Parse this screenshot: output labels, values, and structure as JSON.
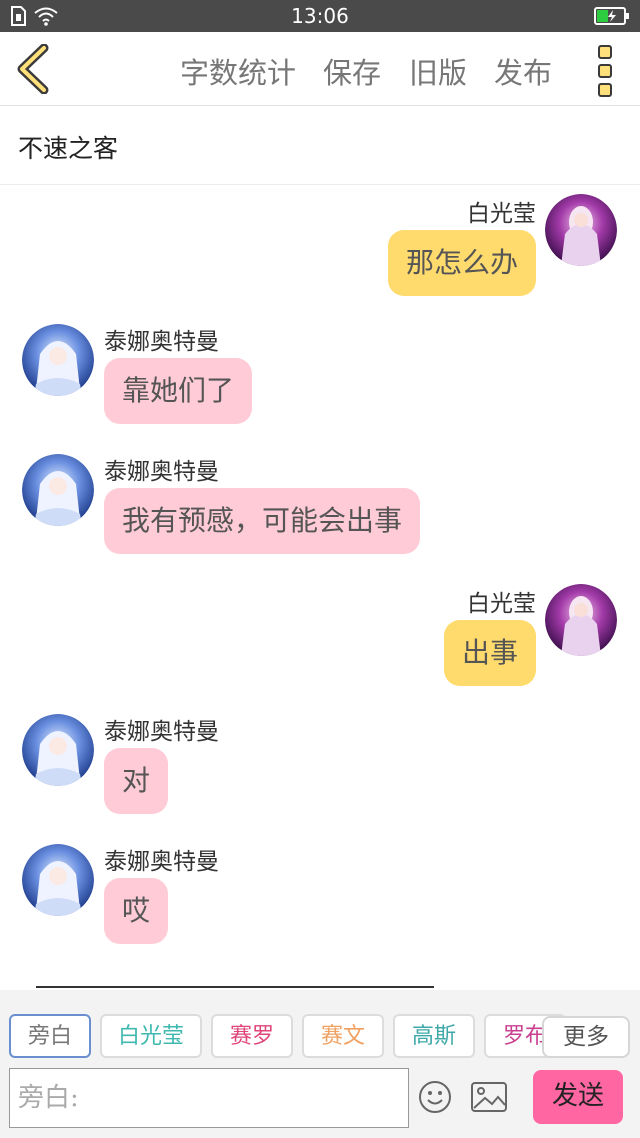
{
  "status_bar": {
    "time": "13:06"
  },
  "nav": {
    "actions": [
      "字数统计",
      "保存",
      "旧版",
      "发布"
    ]
  },
  "story": {
    "title": "不速之客"
  },
  "messages": [
    {
      "side": "right",
      "name": "白光莹",
      "text": "那怎么办"
    },
    {
      "side": "left",
      "name": "泰娜奥特曼",
      "text": "靠她们了"
    },
    {
      "side": "left",
      "name": "泰娜奥特曼",
      "text": "我有预感，可能会出事"
    },
    {
      "side": "right",
      "name": "白光莹",
      "text": "出事"
    },
    {
      "side": "left",
      "name": "泰娜奥特曼",
      "text": "对"
    },
    {
      "side": "left",
      "name": "泰娜奥特曼",
      "text": "哎"
    }
  ],
  "characters": [
    {
      "label": "旁白",
      "color": "#777777",
      "active": true
    },
    {
      "label": "白光莹",
      "color": "#3fb8b0",
      "active": false
    },
    {
      "label": "赛罗",
      "color": "#e0457a",
      "active": false
    },
    {
      "label": "赛文",
      "color": "#f0a060",
      "active": false
    },
    {
      "label": "高斯",
      "color": "#3fa8a8",
      "active": false
    },
    {
      "label": "罗布",
      "color": "#c94090",
      "active": false
    }
  ],
  "more_label": "更多",
  "input": {
    "placeholder": "旁白:"
  },
  "send_label": "发送",
  "colors": {
    "right_bubble": "#ffdb6e",
    "left_bubble": "#ffcbd7",
    "send": "#ff66a2",
    "icon_yellow": "#ffe07a"
  },
  "icons": {
    "back": "chevron-left-icon",
    "menu": "three-dots-vertical-icon",
    "emoji": "smiley-icon",
    "image": "image-icon"
  }
}
